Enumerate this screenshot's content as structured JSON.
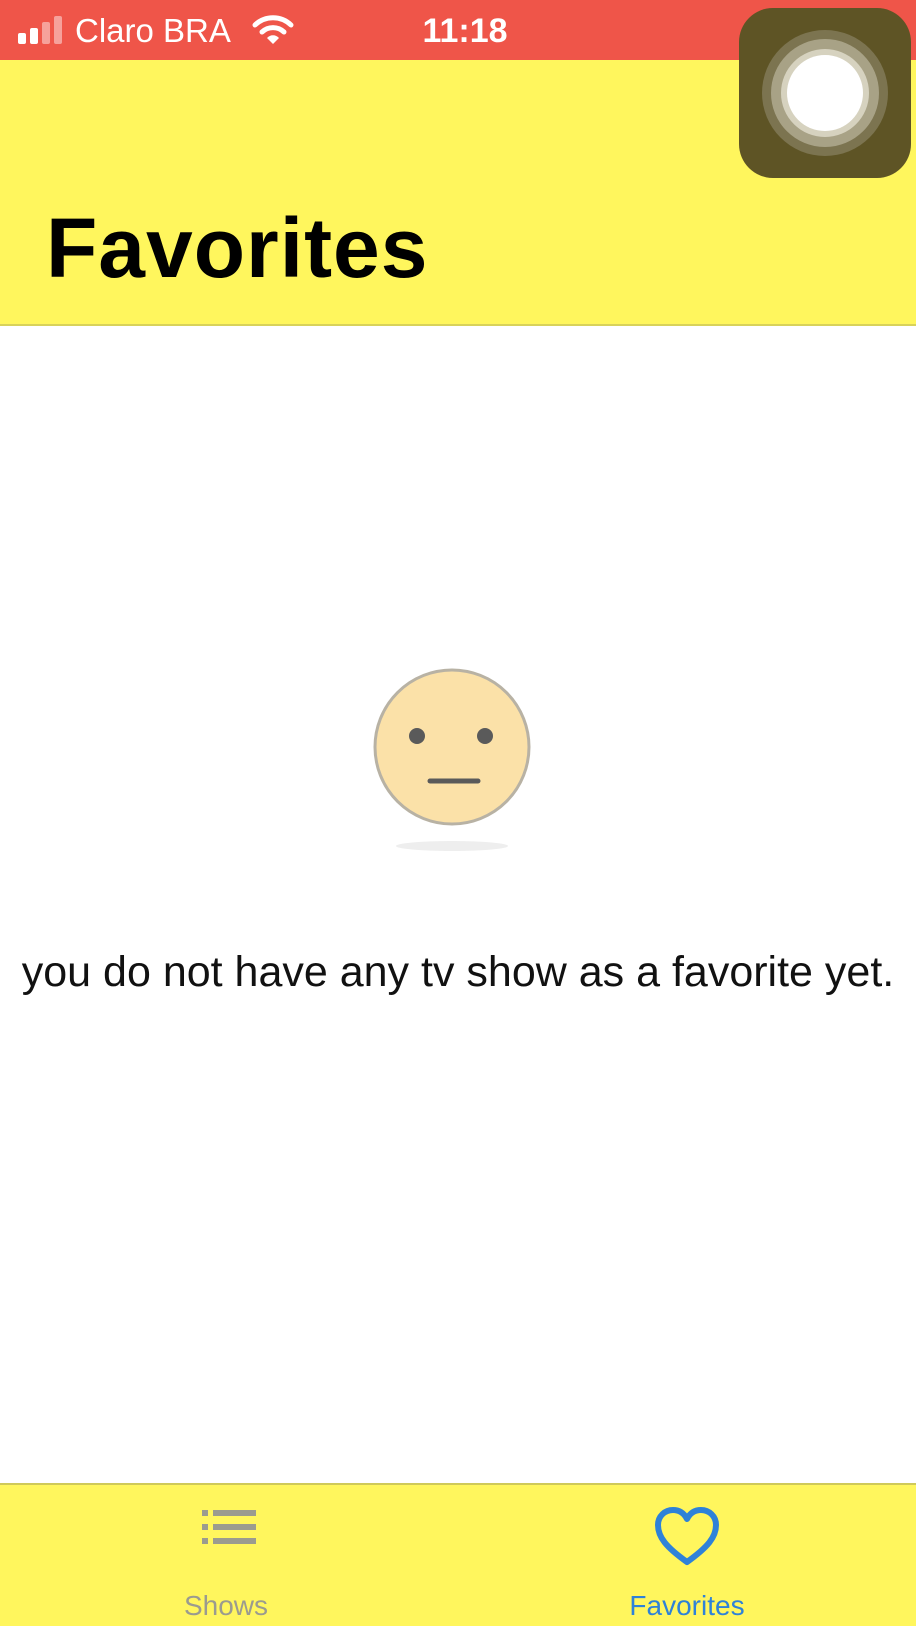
{
  "status_bar": {
    "carrier": "Claro BRA",
    "time": "11:18"
  },
  "header": {
    "title": "Favorites"
  },
  "empty_state": {
    "message": "you do not have any tv show as a favorite yet."
  },
  "tab_bar": {
    "tabs": [
      {
        "label": "Shows",
        "icon": "list-icon",
        "selected": false
      },
      {
        "label": "Favorites",
        "icon": "heart-icon",
        "selected": true
      }
    ]
  },
  "colors": {
    "status_bar": "#ef5549",
    "nav_background": "#fff65d",
    "tab_selected": "#2e82d8",
    "tab_unselected": "#9b9b8f",
    "face_fill": "#fbe1a8"
  }
}
